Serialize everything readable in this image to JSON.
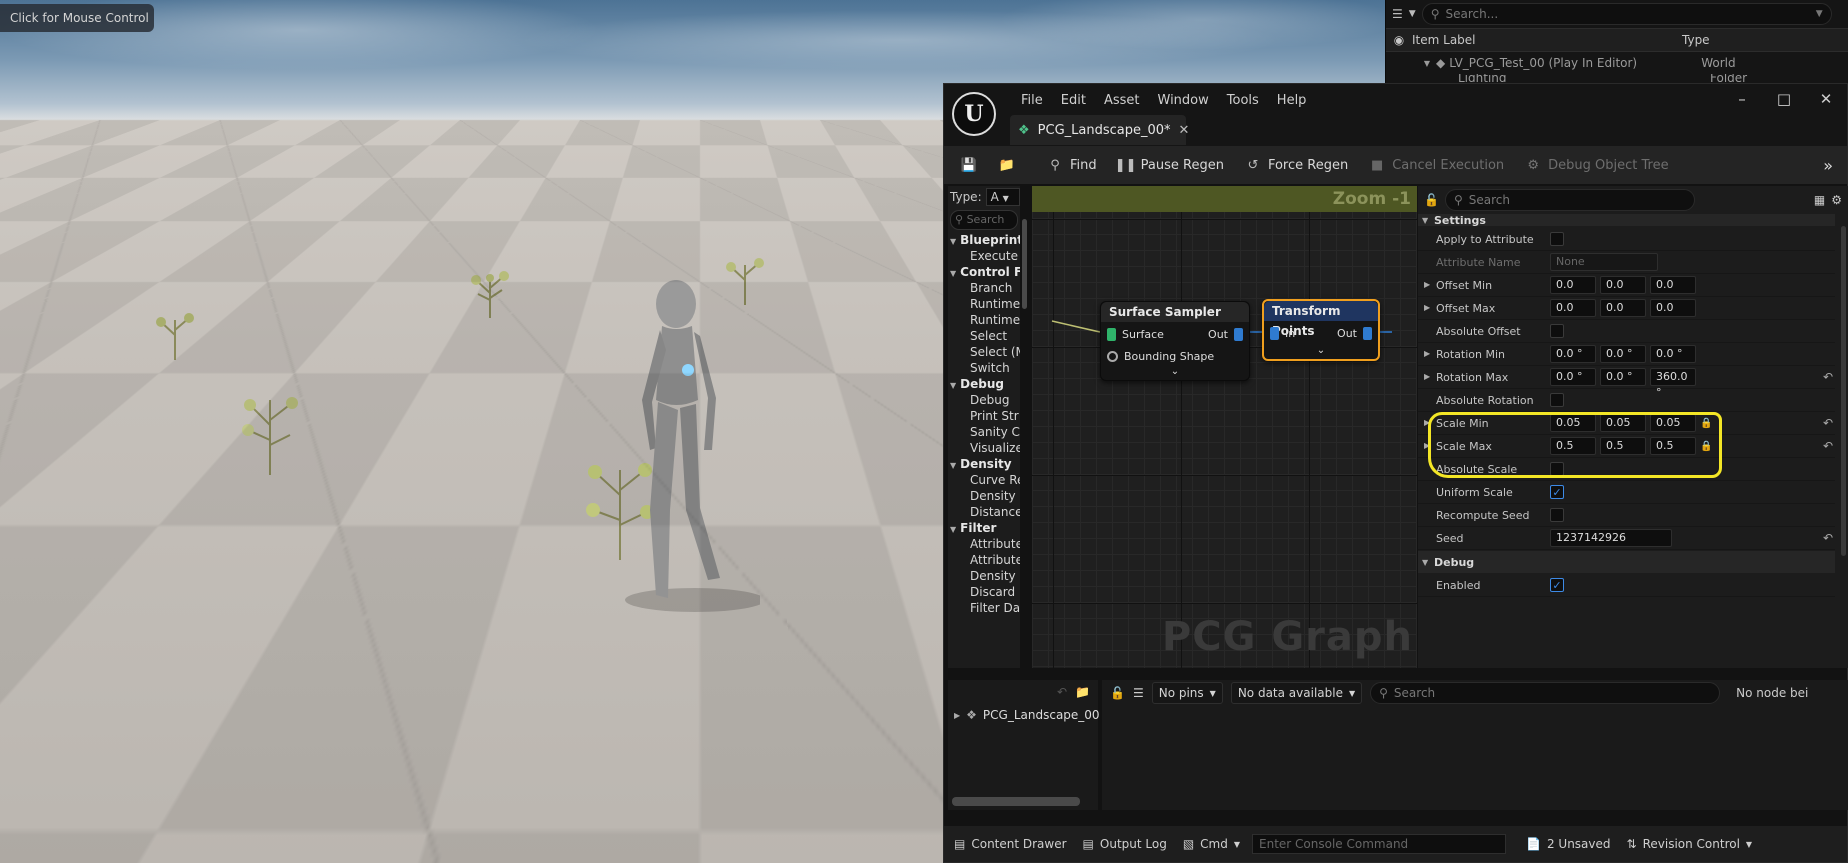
{
  "viewport": {
    "mouse_hint": "Click for Mouse Control"
  },
  "outliner": {
    "search_placeholder": "Search...",
    "columns": [
      "Item Label",
      "Type"
    ],
    "rows": [
      {
        "label": "LV_PCG_Test_00 (Play In Editor)",
        "type": "World"
      },
      {
        "label": "Lighting",
        "type": "Folder"
      }
    ]
  },
  "pcg_editor": {
    "menu": [
      "File",
      "Edit",
      "Asset",
      "Window",
      "Tools",
      "Help"
    ],
    "tab_title": "PCG_Landscape_00*",
    "toolbar": {
      "find": "Find",
      "pause_regen": "Pause Regen",
      "force_regen": "Force Regen",
      "cancel_execution": "Cancel Execution",
      "debug_object_tree": "Debug Object Tree"
    },
    "palette": {
      "type_label": "Type:",
      "type_value": "A",
      "search_placeholder": "Search",
      "entries": [
        {
          "kind": "cat",
          "text": "Blueprint"
        },
        {
          "kind": "item",
          "text": "Execute"
        },
        {
          "kind": "cat",
          "text": "Control Flow"
        },
        {
          "kind": "item",
          "text": "Branch"
        },
        {
          "kind": "item",
          "text": "Runtime"
        },
        {
          "kind": "item",
          "text": "Runtime"
        },
        {
          "kind": "item",
          "text": "Select"
        },
        {
          "kind": "item",
          "text": "Select (M"
        },
        {
          "kind": "item",
          "text": "Switch"
        },
        {
          "kind": "cat",
          "text": "Debug"
        },
        {
          "kind": "item",
          "text": "Debug"
        },
        {
          "kind": "item",
          "text": "Print Str"
        },
        {
          "kind": "item",
          "text": "Sanity C"
        },
        {
          "kind": "item",
          "text": "Visualize"
        },
        {
          "kind": "cat",
          "text": "Density"
        },
        {
          "kind": "item",
          "text": "Curve Re"
        },
        {
          "kind": "item",
          "text": "Density"
        },
        {
          "kind": "item",
          "text": "Distance"
        },
        {
          "kind": "cat",
          "text": "Filter"
        },
        {
          "kind": "item",
          "text": "Attribute"
        },
        {
          "kind": "item",
          "text": "Attribute"
        },
        {
          "kind": "item",
          "text": "Density"
        },
        {
          "kind": "item",
          "text": "Discard"
        },
        {
          "kind": "item",
          "text": "Filter Da"
        }
      ]
    },
    "graph": {
      "zoom": "Zoom -1",
      "watermark": "PCG Graph",
      "node_surface": {
        "title": "Surface Sampler",
        "pin_surface": "Surface",
        "pin_bounding": "Bounding Shape",
        "pin_out": "Out"
      },
      "node_transform": {
        "title": "Transform Points",
        "pin_in": "In",
        "pin_out": "Out"
      }
    },
    "details": {
      "search_placeholder": "Search",
      "section_settings": "Settings",
      "section_debug": "Debug",
      "apply_to_attribute": "Apply to Attribute",
      "attribute_name": "Attribute Name",
      "attribute_name_value": "None",
      "offset_min": {
        "label": "Offset Min",
        "x": "0.0",
        "y": "0.0",
        "z": "0.0"
      },
      "offset_max": {
        "label": "Offset Max",
        "x": "0.0",
        "y": "0.0",
        "z": "0.0"
      },
      "absolute_offset": "Absolute Offset",
      "rotation_min": {
        "label": "Rotation Min",
        "x": "0.0 °",
        "y": "0.0 °",
        "z": "0.0 °"
      },
      "rotation_max": {
        "label": "Rotation Max",
        "x": "0.0 °",
        "y": "0.0 °",
        "z": "360.0 °"
      },
      "absolute_rotation": "Absolute Rotation",
      "scale_min": {
        "label": "Scale Min",
        "x": "0.05",
        "y": "0.05",
        "z": "0.05"
      },
      "scale_max": {
        "label": "Scale Max",
        "x": "0.5",
        "y": "0.5",
        "z": "0.5"
      },
      "absolute_scale": "Absolute Scale",
      "uniform_scale": "Uniform Scale",
      "recompute_seed": "Recompute Seed",
      "seed": "Seed",
      "seed_value": "1237142926",
      "enabled": "Enabled"
    },
    "bottom": {
      "tree_item": "PCG_Landscape_00",
      "pins_dropdown": "No pins",
      "data_dropdown": "No data available",
      "search_placeholder": "Search",
      "no_node": "No node bei"
    },
    "statusbar": {
      "content_drawer": "Content Drawer",
      "output_log": "Output Log",
      "cmd": "Cmd",
      "console_placeholder": "Enter Console Command",
      "unsaved": "2 Unsaved",
      "revision_control": "Revision Control"
    }
  }
}
